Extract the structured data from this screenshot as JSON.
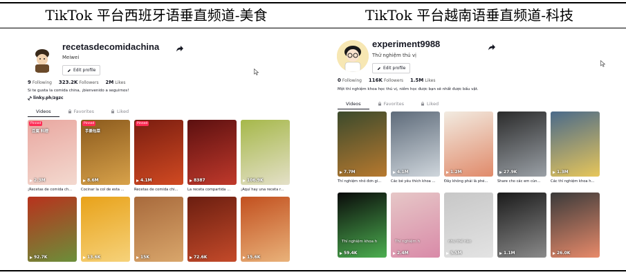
{
  "captions": {
    "left": "TikTok 平台西班牙语垂直频道-美食",
    "right": "TikTok 平台越南语垂直频道-科技"
  },
  "left_profile": {
    "username": "recetasdecomidachina",
    "nickname": "Meiwei",
    "edit_label": "Edit profile",
    "stats": [
      {
        "value": "9",
        "label": "Following"
      },
      {
        "value": "323.2K",
        "label": "Followers"
      },
      {
        "value": "2M",
        "label": "Likes"
      }
    ],
    "bio": "Si te gusta la comida china, ¡bienvenido a seguirnos!",
    "link": "linky.ph/zgzc",
    "tabs": [
      "Videos",
      "Favorites",
      "Liked"
    ],
    "pinned_label": "Pinned",
    "videos": [
      {
        "views": "2.3M",
        "title": "¡Recetas de comida ch...",
        "overlay": "豆腐 料理",
        "pinned": true,
        "c1": "#e9a7a0",
        "c2": "#f3d9cf"
      },
      {
        "views": "8.6M",
        "title": "Cocinar la col de esta ...",
        "overlay": "手撕包菜",
        "pinned": true,
        "c1": "#8b5a1d",
        "c2": "#d8a24a"
      },
      {
        "views": "4.1M",
        "title": "Recetas de comida chi...",
        "overlay": "",
        "pinned": true,
        "c1": "#7a1d10",
        "c2": "#d14a22"
      },
      {
        "views": "8387",
        "title": "La receta compartida ...",
        "overlay": "",
        "pinned": false,
        "c1": "#5c1010",
        "c2": "#c0392b"
      },
      {
        "views": "106.9K",
        "title": "¡Aquí hay una receta r...",
        "overlay": "",
        "pinned": false,
        "c1": "#a6b84a",
        "c2": "#e4e0c8"
      },
      {
        "views": "92.7K",
        "title": "",
        "overlay": "",
        "pinned": false,
        "c1": "#b8321d",
        "c2": "#6b8f3a"
      },
      {
        "views": "13.6K",
        "title": "",
        "overlay": "",
        "pinned": false,
        "c1": "#e8a21a",
        "c2": "#f6d27a"
      },
      {
        "views": "15K",
        "title": "",
        "overlay": "",
        "pinned": false,
        "c1": "#a86a3c",
        "c2": "#d9a66b"
      },
      {
        "views": "72.6K",
        "title": "",
        "overlay": "",
        "pinned": false,
        "c1": "#6b1e10",
        "c2": "#c44a2a"
      },
      {
        "views": "15.6K",
        "title": "",
        "overlay": "",
        "pinned": false,
        "c1": "#c2501f",
        "c2": "#e9b27a"
      }
    ]
  },
  "right_profile": {
    "username": "experiment9988",
    "nickname": "Thử nghiệm thú vị",
    "edit_label": "Edit profile",
    "stats": [
      {
        "value": "0",
        "label": "Following"
      },
      {
        "value": "116K",
        "label": "Followers"
      },
      {
        "value": "1.5M",
        "label": "Likes"
      }
    ],
    "bio": "Một thí nghiệm khoa học thú vị, niềm học được bạn sẽ nhất được bấu vật.",
    "tabs": [
      "Videos",
      "Favorites",
      "Liked"
    ],
    "videos": [
      {
        "views": "7.7M",
        "title": "Thí nghiệm nhỏ đơn gi...",
        "overlay": "",
        "c1": "#3b4a2c",
        "c2": "#b7792f"
      },
      {
        "views": "4.1M",
        "title": "Các bé yêu thích khoa ...",
        "overlay": "",
        "c1": "#5e6b7a",
        "c2": "#cfd6dc"
      },
      {
        "views": "1.2M",
        "title": "Đây không phải là phé...",
        "overlay": "",
        "c1": "#f2ebe1",
        "c2": "#e08a6a"
      },
      {
        "views": "27.9K",
        "title": "Share cho các em cùn...",
        "overlay": "",
        "c1": "#2b2b2b",
        "c2": "#9aa0a6"
      },
      {
        "views": "1.3M",
        "title": "Các thí nghiệm khoa h...",
        "overlay": "",
        "c1": "#4a6a8a",
        "c2": "#e7c65a"
      },
      {
        "views": "59.4K",
        "title": "",
        "overlay": "Thí nghiệm khoa h",
        "c1": "#0a0a0a",
        "c2": "#4caf50"
      },
      {
        "views": "2.4M",
        "title": "",
        "overlay": "Thí nghiệm h",
        "c1": "#e6c7c7",
        "c2": "#d98aa8"
      },
      {
        "views": "5.5M",
        "title": "",
        "overlay": "như thế nào",
        "c1": "#c7c7c7",
        "c2": "#e3e3e3"
      },
      {
        "views": "1.1M",
        "title": "",
        "overlay": "",
        "c1": "#1b1b1b",
        "c2": "#8a8a8a"
      },
      {
        "views": "26.0K",
        "title": "",
        "overlay": "",
        "c1": "#3a3a3a",
        "c2": "#e88a6a"
      }
    ]
  }
}
